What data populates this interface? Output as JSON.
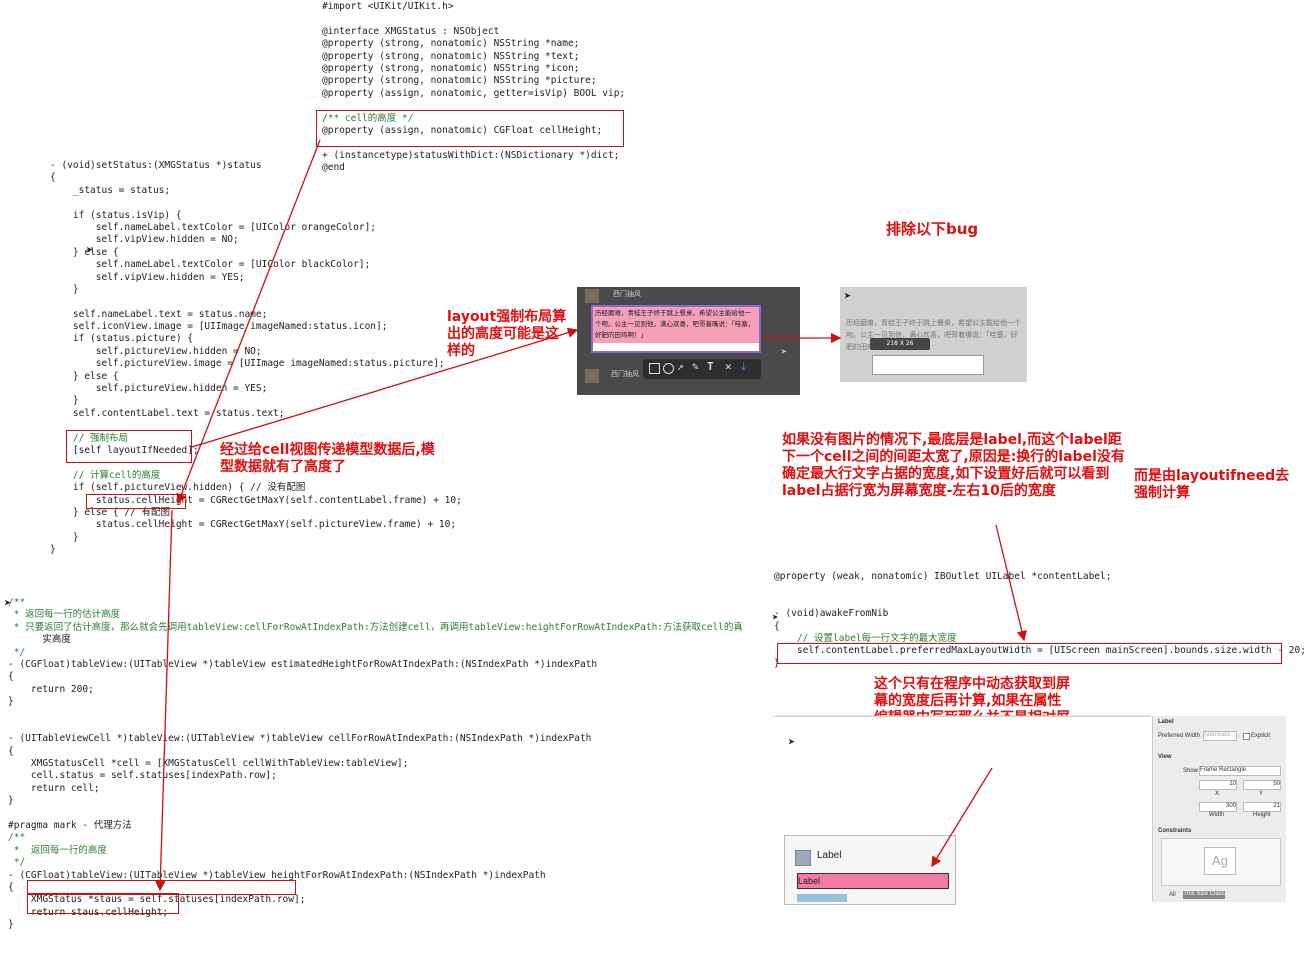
{
  "header_code": [
    "#import <UIKit/UIKit.h>",
    "",
    "@interface XMGStatus : NSObject",
    "@property (strong, nonatomic) NSString *name;",
    "@property (strong, nonatomic) NSString *text;",
    "@property (strong, nonatomic) NSString *icon;",
    "@property (strong, nonatomic) NSString *picture;",
    "@property (assign, nonatomic, getter=isVip) BOOL vip;",
    "",
    "/** cell的高度 */",
    "@property (assign, nonatomic) CGFloat cellHeight;",
    "",
    "+ (instancetype)statusWithDict:(NSDictionary *)dict;",
    "@end"
  ],
  "setstatus_code": [
    "- (void)setStatus:(XMGStatus *)status",
    "{",
    "    _status = status;",
    "",
    "    if (status.isVip) {",
    "        self.nameLabel.textColor = [UIColor orangeColor];",
    "        self.vipView.hidden = NO;",
    "    } else {",
    "        self.nameLabel.textColor = [UIColor blackColor];",
    "        self.vipView.hidden = YES;",
    "    }",
    "",
    "    self.nameLabel.text = status.name;",
    "    self.iconView.image = [UIImage imageNamed:status.icon];",
    "    if (status.picture) {",
    "        self.pictureView.hidden = NO;",
    "        self.pictureView.image = [UIImage imageNamed:status.picture];",
    "    } else {",
    "        self.pictureView.hidden = YES;",
    "    }",
    "    self.contentLabel.text = status.text;",
    "",
    "    // 强制布局",
    "    [self layoutIfNeeded];",
    "",
    "    // 计算cell的高度",
    "    if (self.pictureView.hidden) { // 没有配图",
    "        status.cellHeight = CGRectGetMaxY(self.contentLabel.frame) + 10;",
    "    } else { // 有配图",
    "        status.cellHeight = CGRectGetMaxY(self.pictureView.frame) + 10;",
    "    }",
    "}"
  ],
  "tableview_code": [
    "/**",
    " * 返回每一行的估计高度",
    " * 只要返回了估计高度，那么就会先调用tableView:cellForRowAtIndexPath:方法创建cell，再调用tableView:heightForRowAtIndexPath:方法获取cell的真",
    "      实高度",
    " */",
    "- (CGFloat)tableView:(UITableView *)tableView estimatedHeightForRowAtIndexPath:(NSIndexPath *)indexPath",
    "{",
    "    return 200;",
    "}",
    "",
    "",
    "- (UITableViewCell *)tableView:(UITableView *)tableView cellForRowAtIndexPath:(NSIndexPath *)indexPath",
    "{",
    "    XMGStatusCell *cell = [XMGStatusCell cellWithTableView:tableView];",
    "    cell.status = self.statuses[indexPath.row];",
    "    return cell;",
    "}",
    "",
    "#pragma mark - 代理方法",
    "/**",
    " *  返回每一行的高度",
    " */",
    "- (CGFloat)tableView:(UITableView *)tableView heightForRowAtIndexPath:(NSIndexPath *)indexPath",
    "{",
    "    XMGStatus *staus = self.statuses[indexPath.row];",
    "    return staus.cellHeight;",
    "}"
  ],
  "awake_code": [
    "@property (weak, nonatomic) IBOutlet UILabel *contentLabel;",
    "",
    "",
    "- (void)awakeFromNib",
    "{",
    "    // 设置label每一行文字的最大宽度",
    "    self.contentLabel.preferredMaxLayoutWidth = [UIScreen mainScreen].bounds.size.width - 20;",
    "}"
  ],
  "notes": {
    "bug_title": "排除以下bug",
    "layout_note": "layout强制布局算出的高度可能是这样的",
    "model_note": "经过给cell视图传递模型数据后,模型数据就有了高度了",
    "label_note": "如果没有图片的情况下,最底层是label,而这个label距下一个cell之间的间距太宽了,原因是:换行的label没有确定最大行文字占据的宽度,如下设置好后就可以看到label占据行宽为屏幕宽度-左右10后的宽度",
    "layoutifneed_note": "而是由layoutifneed去强制计算",
    "dynamic_note": "这个只有在程序中动态获取到屏幕的宽度后再计算,如果在属性编辑器中写死那么并不是相对屏幕宽度而言的,无法适配;"
  },
  "screenshot1": {
    "name_top": "西门抽风",
    "text": "历经磨难，青蛙王子终于跳上餐桌，希望公主能给他一个吻。公主一见到他，满心欢喜，吧哥着嘴说：「哇塞，好肥的田鸡啊！」",
    "name_bottom": "西门抽风",
    "toolbar_icons": [
      "rect-icon",
      "circle-icon",
      "arrow-icon",
      "pen-icon",
      "text-icon",
      "close-icon",
      "download-icon"
    ]
  },
  "screenshot2": {
    "text": "历经磨难，青蛙王子终于跳上餐桌，希望公主能给他一个吻。公主一见到他，满心欢喜，吧哥着嘴说：「哇塞，好肥的田鸡啊！」",
    "size_badge": "218 X 26"
  },
  "ib_canvas": {
    "label_title": "Label",
    "label_text": "Label"
  },
  "inspector": {
    "label_header": "Label",
    "preferred_width_label": "Preferred Width",
    "preferred_width_value": "Automatic",
    "explicit_label": "Explicit",
    "view_header": "View",
    "show_label": "Show",
    "show_value": "Frame Rectangle",
    "x_value": "10",
    "y_value": "50",
    "x_label": "X",
    "y_label": "Y",
    "width_value": "300",
    "height_value": "21",
    "width_label": "Width",
    "height_label": "Height",
    "constraints_header": "Constraints",
    "ag_glyph": "Ag",
    "all_label": "All",
    "size_class": "This Size Class"
  }
}
